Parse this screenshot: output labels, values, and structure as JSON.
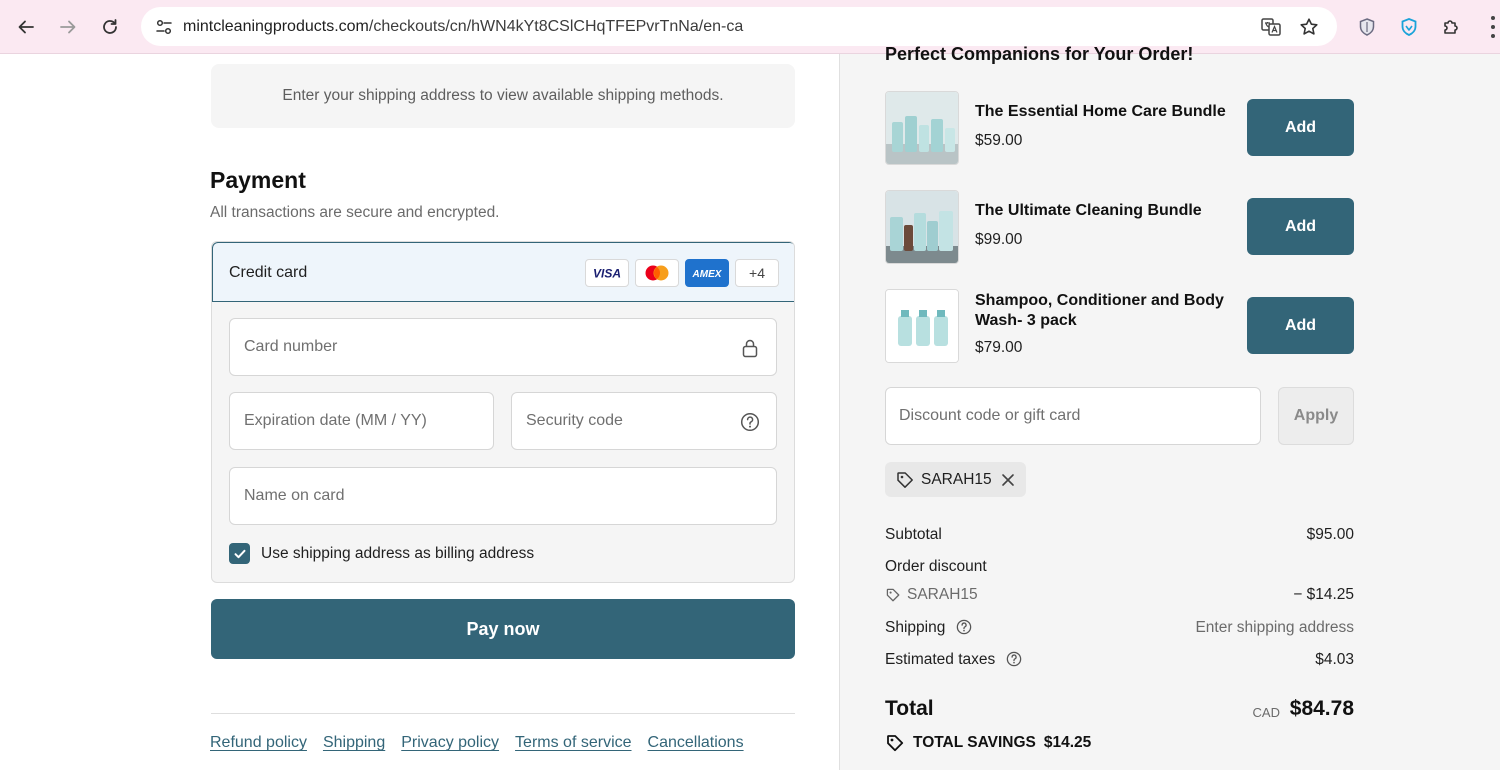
{
  "browser": {
    "url_host": "mintcleaningproducts.com",
    "url_path": "/checkouts/cn/hWN4kYt8CSlCHqTFEPvrTnNa/en-ca"
  },
  "shipping_method": {
    "message": "Enter your shipping address to view available shipping methods."
  },
  "payment": {
    "title": "Payment",
    "subtitle": "All transactions are secure and encrypted.",
    "method_label": "Credit card",
    "card_brands": [
      "VISA",
      "Mastercard",
      "AMEX"
    ],
    "more_brands": "+4",
    "card_number_placeholder": "Card number",
    "expiration_placeholder": "Expiration date (MM / YY)",
    "security_code_placeholder": "Security code",
    "name_on_card_placeholder": "Name on card",
    "billing_same_label": "Use shipping address as billing address",
    "billing_same_checked": true,
    "pay_button": "Pay now"
  },
  "footer": {
    "links": [
      "Refund policy",
      "Shipping",
      "Privacy policy",
      "Terms of service",
      "Cancellations"
    ]
  },
  "companions": {
    "title": "Perfect Companions for Your Order!",
    "add_label": "Add",
    "products": [
      {
        "name": "The Essential Home Care Bundle",
        "price": "$59.00"
      },
      {
        "name": "The Ultimate Cleaning Bundle",
        "price": "$99.00"
      },
      {
        "name": "Shampoo, Conditioner and Body Wash- 3 pack",
        "price": "$79.00"
      }
    ]
  },
  "discount": {
    "placeholder": "Discount code or gift card",
    "apply_label": "Apply",
    "applied_code": "SARAH15"
  },
  "summary": {
    "subtotal_label": "Subtotal",
    "subtotal_value": "$95.00",
    "order_discount_label": "Order discount",
    "discount_code": "SARAH15",
    "discount_value": "− $14.25",
    "shipping_label": "Shipping",
    "shipping_value": "Enter shipping address",
    "taxes_label": "Estimated taxes",
    "taxes_value": "$4.03",
    "total_label": "Total",
    "currency": "CAD",
    "total_value": "$84.78",
    "savings_label": "TOTAL SAVINGS",
    "savings_value": "$14.25"
  },
  "colors": {
    "accent": "#336578",
    "chrome_bg": "#fbe9f2",
    "panel_bg": "#f5f5f5"
  }
}
